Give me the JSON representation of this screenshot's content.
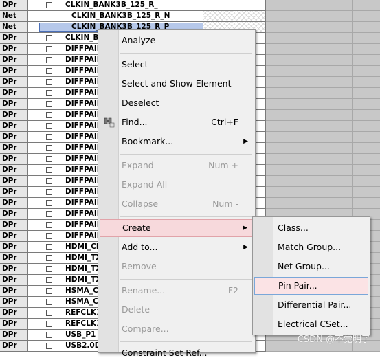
{
  "rows": [
    {
      "type": "DPr",
      "expander": "minus",
      "name": "CLKIN_BANK3B_125_R_",
      "child": false,
      "hatch": false,
      "selected": false
    },
    {
      "type": "Net",
      "expander": "",
      "name": "CLKIN_BANK3B_125_R_N",
      "child": true,
      "hatch": true,
      "selected": false
    },
    {
      "type": "Net",
      "expander": "",
      "name": "CLKIN_BANK3B_125_R_P",
      "child": true,
      "hatch": true,
      "selected": true
    },
    {
      "type": "DPr",
      "expander": "plus",
      "name": "CLKIN_B",
      "child": false,
      "hatch": false,
      "selected": false
    },
    {
      "type": "DPr",
      "expander": "plus",
      "name": "DIFFPAIR",
      "child": false,
      "hatch": false,
      "selected": false
    },
    {
      "type": "DPr",
      "expander": "plus",
      "name": "DIFFPAIR",
      "child": false,
      "hatch": false,
      "selected": false
    },
    {
      "type": "DPr",
      "expander": "plus",
      "name": "DIFFPAIR",
      "child": false,
      "hatch": false,
      "selected": false
    },
    {
      "type": "DPr",
      "expander": "plus",
      "name": "DIFFPAIR",
      "child": false,
      "hatch": false,
      "selected": false
    },
    {
      "type": "DPr",
      "expander": "plus",
      "name": "DIFFPAIR",
      "child": false,
      "hatch": false,
      "selected": false
    },
    {
      "type": "DPr",
      "expander": "plus",
      "name": "DIFFPAIR",
      "child": false,
      "hatch": false,
      "selected": false
    },
    {
      "type": "DPr",
      "expander": "plus",
      "name": "DIFFPAIR",
      "child": false,
      "hatch": false,
      "selected": false
    },
    {
      "type": "DPr",
      "expander": "plus",
      "name": "DIFFPAIR",
      "child": false,
      "hatch": false,
      "selected": false
    },
    {
      "type": "DPr",
      "expander": "plus",
      "name": "DIFFPAIR",
      "child": false,
      "hatch": false,
      "selected": false
    },
    {
      "type": "DPr",
      "expander": "plus",
      "name": "DIFFPAIR",
      "child": false,
      "hatch": false,
      "selected": false
    },
    {
      "type": "DPr",
      "expander": "plus",
      "name": "DIFFPAIR",
      "child": false,
      "hatch": false,
      "selected": false
    },
    {
      "type": "DPr",
      "expander": "plus",
      "name": "DIFFPAIR",
      "child": false,
      "hatch": false,
      "selected": false
    },
    {
      "type": "DPr",
      "expander": "plus",
      "name": "DIFFPAIR",
      "child": false,
      "hatch": false,
      "selected": false
    },
    {
      "type": "DPr",
      "expander": "plus",
      "name": "DIFFPAIR",
      "child": false,
      "hatch": false,
      "selected": false
    },
    {
      "type": "DPr",
      "expander": "plus",
      "name": "DIFFPAIR",
      "child": false,
      "hatch": false,
      "selected": false
    },
    {
      "type": "DPr",
      "expander": "plus",
      "name": "DIFFPAIR",
      "child": false,
      "hatch": false,
      "selected": false
    },
    {
      "type": "DPr",
      "expander": "plus",
      "name": "DIFFPAIR",
      "child": false,
      "hatch": false,
      "selected": false
    },
    {
      "type": "DPr",
      "expander": "plus",
      "name": "DIFFPAIR",
      "child": false,
      "hatch": false,
      "selected": false
    },
    {
      "type": "DPr",
      "expander": "plus",
      "name": "HDMI_CL",
      "child": false,
      "hatch": false,
      "selected": false
    },
    {
      "type": "DPr",
      "expander": "plus",
      "name": "HDMI_TX",
      "child": false,
      "hatch": false,
      "selected": false
    },
    {
      "type": "DPr",
      "expander": "plus",
      "name": "HDMI_TX",
      "child": false,
      "hatch": false,
      "selected": false
    },
    {
      "type": "DPr",
      "expander": "plus",
      "name": "HDMI_TX",
      "child": false,
      "hatch": false,
      "selected": false
    },
    {
      "type": "DPr",
      "expander": "plus",
      "name": "HSMA_C",
      "child": false,
      "hatch": false,
      "selected": false
    },
    {
      "type": "DPr",
      "expander": "plus",
      "name": "HSMA_C",
      "child": false,
      "hatch": false,
      "selected": false
    },
    {
      "type": "DPr",
      "expander": "plus",
      "name": "REFCLK1",
      "child": false,
      "hatch": false,
      "selected": false
    },
    {
      "type": "DPr",
      "expander": "plus",
      "name": "REFCLK1",
      "child": false,
      "hatch": false,
      "selected": false
    },
    {
      "type": "DPr",
      "expander": "plus",
      "name": "USB_P1",
      "child": false,
      "hatch": false,
      "selected": false
    },
    {
      "type": "DPr",
      "expander": "plus",
      "name": "USB2.0D",
      "child": false,
      "hatch": false,
      "selected": false
    }
  ],
  "context_menu": {
    "items": [
      {
        "label": "Analyze",
        "shortcut": "",
        "submenu": false,
        "disabled": false,
        "icon": "",
        "highlighted": false
      },
      {
        "sep": true
      },
      {
        "label": "Select",
        "shortcut": "",
        "submenu": false,
        "disabled": false,
        "icon": "",
        "highlighted": false
      },
      {
        "label": "Select and Show Element",
        "shortcut": "",
        "submenu": false,
        "disabled": false,
        "icon": "",
        "highlighted": false
      },
      {
        "label": "Deselect",
        "shortcut": "",
        "submenu": false,
        "disabled": false,
        "icon": "",
        "highlighted": false
      },
      {
        "label": "Find...",
        "shortcut": "Ctrl+F",
        "submenu": false,
        "disabled": false,
        "icon": "find-icon",
        "highlighted": false
      },
      {
        "label": "Bookmark...",
        "shortcut": "",
        "submenu": true,
        "disabled": false,
        "icon": "",
        "highlighted": false
      },
      {
        "sep": true
      },
      {
        "label": "Expand",
        "shortcut": "Num +",
        "submenu": false,
        "disabled": true,
        "icon": "",
        "highlighted": false
      },
      {
        "label": "Expand All",
        "shortcut": "",
        "submenu": false,
        "disabled": true,
        "icon": "",
        "highlighted": false
      },
      {
        "label": "Collapse",
        "shortcut": "Num -",
        "submenu": false,
        "disabled": true,
        "icon": "",
        "highlighted": false
      },
      {
        "sep": true
      },
      {
        "label": "Create",
        "shortcut": "",
        "submenu": true,
        "disabled": false,
        "icon": "",
        "highlighted": true
      },
      {
        "label": "Add to...",
        "shortcut": "",
        "submenu": true,
        "disabled": false,
        "icon": "",
        "highlighted": false
      },
      {
        "label": "Remove",
        "shortcut": "",
        "submenu": false,
        "disabled": true,
        "icon": "",
        "highlighted": false
      },
      {
        "sep": true
      },
      {
        "label": "Rename...",
        "shortcut": "F2",
        "submenu": false,
        "disabled": true,
        "icon": "",
        "highlighted": false
      },
      {
        "label": "Delete",
        "shortcut": "",
        "submenu": false,
        "disabled": true,
        "icon": "",
        "highlighted": false
      },
      {
        "label": "Compare...",
        "shortcut": "",
        "submenu": false,
        "disabled": true,
        "icon": "",
        "highlighted": false
      },
      {
        "sep": true
      },
      {
        "label": "Constraint Set Ref...",
        "shortcut": "",
        "submenu": false,
        "disabled": false,
        "icon": "",
        "highlighted": false
      }
    ]
  },
  "create_submenu": {
    "items": [
      {
        "label": "Class...",
        "highlighted": false
      },
      {
        "label": "Match Group...",
        "highlighted": false
      },
      {
        "label": "Net Group...",
        "highlighted": false
      },
      {
        "label": "Pin Pair...",
        "highlighted": true
      },
      {
        "label": "Differential Pair...",
        "highlighted": false
      },
      {
        "label": "Electrical CSet...",
        "highlighted": false
      }
    ]
  },
  "watermark": "CSDN @不觉明了",
  "colors": {
    "menu_highlight": "#f7d9dc",
    "submenu_highlight_border": "#7aa7d9",
    "selected_row": "#b6c8ea"
  }
}
